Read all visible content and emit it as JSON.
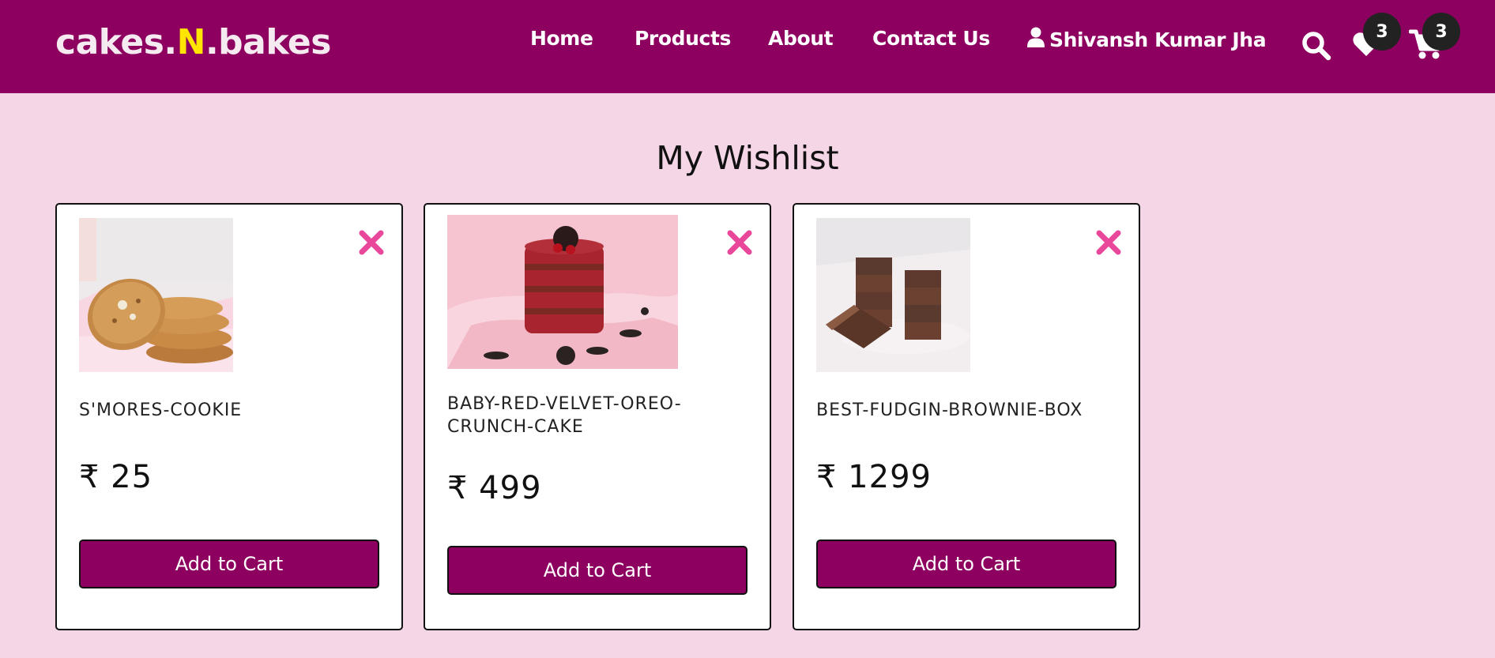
{
  "brand": {
    "part1": "cakes.",
    "accent": "N",
    "part2": ".bakes"
  },
  "nav": {
    "home": "Home",
    "products": "Products",
    "about": "About",
    "contact": "Contact Us",
    "user_name": "Shivansh Kumar Jha"
  },
  "counts": {
    "wishlist": "3",
    "cart": "3"
  },
  "page": {
    "title": "My Wishlist"
  },
  "items": [
    {
      "name": "S'MORES-COOKIE",
      "price": "₹ 25",
      "button": "Add to Cart"
    },
    {
      "name": "BABY-RED-VELVET-OREO-CRUNCH-CAKE",
      "price": "₹ 499",
      "button": "Add to Cart"
    },
    {
      "name": "BEST-FUDGIN-BROWNIE-BOX",
      "price": "₹ 1299",
      "button": "Add to Cart"
    }
  ],
  "colors": {
    "navbar": "#8e0060",
    "background": "#f5d6e6",
    "accent": "#ffe500",
    "remove_icon": "#e8479a",
    "badge": "#222222"
  }
}
